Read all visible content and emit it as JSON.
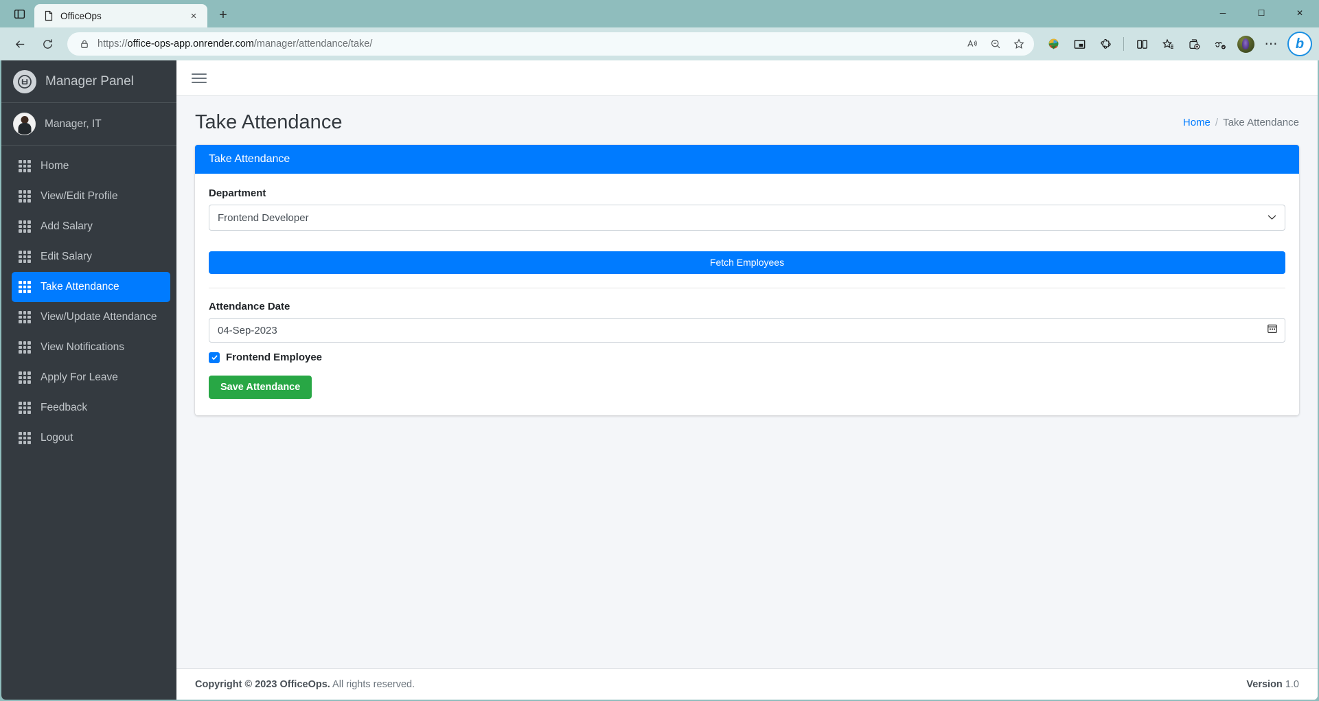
{
  "browser": {
    "tab": {
      "title": "OfficeOps",
      "favicon_icon": "page-icon",
      "close_icon": "×"
    },
    "new_tab_label": "+",
    "sidebar_toggle_icon": "split-pane-icon",
    "window_controls": {
      "minimize": "─",
      "maximize": "☐",
      "close": "✕"
    },
    "nav": {
      "back_icon": "back-arrow-icon",
      "reload_icon": "reload-icon"
    },
    "url": {
      "scheme": "https://",
      "host": "office-ops-app.onrender.com",
      "path": "/manager/attendance/take/",
      "lock_icon": "lock-icon"
    },
    "url_actions": [
      "read-aloud-icon",
      "zoom-out-icon",
      "favorite-star-icon"
    ],
    "extensions": [
      "idm-download-icon",
      "picture-in-picture-icon",
      "puzzle-extension-icon",
      "split-screen-icon",
      "collections-star-icon",
      "add-tab-group-icon",
      "browser-essentials-icon"
    ],
    "profile_icon": "profile-avatar",
    "more_icon": "⋯",
    "copilot_icon": "bing-copilot-icon"
  },
  "sidebar": {
    "brand": {
      "label": "Manager Panel",
      "logo_icon": "office-ops-logo-icon"
    },
    "user": {
      "name": "Manager, IT",
      "avatar_icon": "user-avatar"
    },
    "items": [
      {
        "label": "Home",
        "icon": "grid-icon",
        "active": false
      },
      {
        "label": "View/Edit Profile",
        "icon": "grid-icon",
        "active": false
      },
      {
        "label": "Add Salary",
        "icon": "grid-icon",
        "active": false
      },
      {
        "label": "Edit Salary",
        "icon": "grid-icon",
        "active": false
      },
      {
        "label": "Take Attendance",
        "icon": "grid-icon",
        "active": true
      },
      {
        "label": "View/Update Attendance",
        "icon": "grid-icon",
        "active": false
      },
      {
        "label": "View Notifications",
        "icon": "grid-icon",
        "active": false
      },
      {
        "label": "Apply For Leave",
        "icon": "grid-icon",
        "active": false
      },
      {
        "label": "Feedback",
        "icon": "grid-icon",
        "active": false
      },
      {
        "label": "Logout",
        "icon": "grid-icon",
        "active": false
      }
    ]
  },
  "topbar": {
    "menu_toggle_icon": "hamburger-icon"
  },
  "page": {
    "title": "Take Attendance",
    "breadcrumb": {
      "home": "Home",
      "separator": "/",
      "current": "Take Attendance"
    }
  },
  "card": {
    "header": "Take Attendance",
    "department": {
      "label": "Department",
      "value": "Frontend Developer",
      "caret_icon": "chevron-down-icon"
    },
    "fetch_button": "Fetch Employees",
    "attendance_date": {
      "label": "Attendance Date",
      "value": "04-Sep-2023",
      "picker_icon": "calendar-icon"
    },
    "employee_checkbox": {
      "label": "Frontend Employee",
      "checked": true,
      "check_glyph": "✓"
    },
    "save_button": "Save Attendance"
  },
  "footer": {
    "copyright_bold": "Copyright © 2023 OfficeOps.",
    "copyright_rest": "All rights reserved.",
    "version_label": "Version",
    "version_value": "1.0"
  },
  "colors": {
    "accent_blue": "#007bff",
    "success_green": "#28a745",
    "sidebar_dark": "#343a40",
    "page_bg": "#f4f6f9",
    "chrome_teal": "#8fbdbd"
  }
}
